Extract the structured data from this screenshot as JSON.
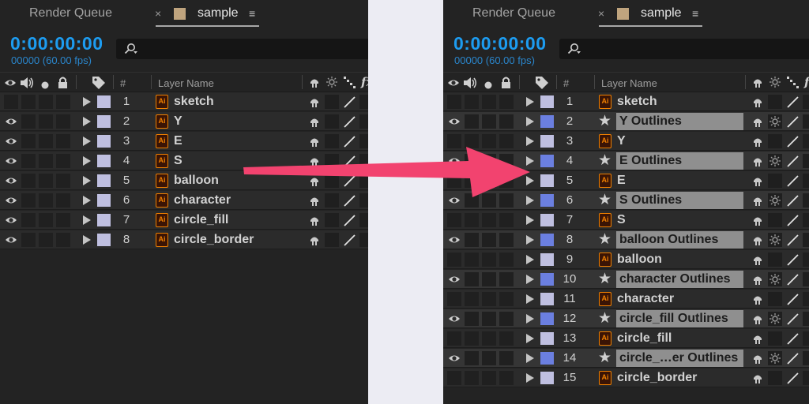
{
  "colors": {
    "accent_timecode": "#1d9cf0",
    "label_lavender": "#bfbfe0",
    "label_blue": "#6b7fe0",
    "ai_orange": "#f08000",
    "arrow": "#f2436f"
  },
  "left_panel": {
    "tabs": {
      "render_queue": "Render Queue",
      "close": "×",
      "active": "sample",
      "menu": "≡"
    },
    "timecode": "0:00:00:00",
    "frame_fps": "00000 (60.00 fps)",
    "search": {
      "icon": "search-icon",
      "placeholder": ""
    },
    "columns": {
      "number": "#",
      "layer_name": "Layer Name",
      "fx": "fx"
    },
    "layers": [
      {
        "num": "1",
        "name": "sketch",
        "type": "ai",
        "visible": false,
        "label": "lavender",
        "selected": false
      },
      {
        "num": "2",
        "name": "Y",
        "type": "ai",
        "visible": true,
        "label": "lavender",
        "selected": false
      },
      {
        "num": "3",
        "name": "E",
        "type": "ai",
        "visible": true,
        "label": "lavender",
        "selected": false
      },
      {
        "num": "4",
        "name": "S",
        "type": "ai",
        "visible": true,
        "label": "lavender",
        "selected": false
      },
      {
        "num": "5",
        "name": "balloon",
        "type": "ai",
        "visible": true,
        "label": "lavender",
        "selected": false
      },
      {
        "num": "6",
        "name": "character",
        "type": "ai",
        "visible": true,
        "label": "lavender",
        "selected": false
      },
      {
        "num": "7",
        "name": "circle_fill",
        "type": "ai",
        "visible": true,
        "label": "lavender",
        "selected": false
      },
      {
        "num": "8",
        "name": "circle_border",
        "type": "ai",
        "visible": true,
        "label": "lavender",
        "selected": false
      }
    ]
  },
  "right_panel": {
    "tabs": {
      "render_queue": "Render Queue",
      "close": "×",
      "active": "sample",
      "menu": "≡"
    },
    "timecode": "0:00:00:00",
    "frame_fps": "00000 (60.00 fps)",
    "search": {
      "icon": "search-icon",
      "placeholder": ""
    },
    "columns": {
      "number": "#",
      "layer_name": "Layer Name",
      "fx": "fx"
    },
    "layers": [
      {
        "num": "1",
        "name": "sketch",
        "type": "ai",
        "visible": false,
        "label": "lavender",
        "selected": false
      },
      {
        "num": "2",
        "name": "Y Outlines",
        "type": "shape",
        "visible": true,
        "label": "blue",
        "selected": true
      },
      {
        "num": "3",
        "name": "Y",
        "type": "ai",
        "visible": false,
        "label": "lavender",
        "selected": false
      },
      {
        "num": "4",
        "name": "E Outlines",
        "type": "shape",
        "visible": true,
        "label": "blue",
        "selected": true
      },
      {
        "num": "5",
        "name": "E",
        "type": "ai",
        "visible": false,
        "label": "lavender",
        "selected": false
      },
      {
        "num": "6",
        "name": "S Outlines",
        "type": "shape",
        "visible": true,
        "label": "blue",
        "selected": true
      },
      {
        "num": "7",
        "name": "S",
        "type": "ai",
        "visible": false,
        "label": "lavender",
        "selected": false
      },
      {
        "num": "8",
        "name": "balloon Outlines",
        "type": "shape",
        "visible": true,
        "label": "blue",
        "selected": true
      },
      {
        "num": "9",
        "name": "balloon",
        "type": "ai",
        "visible": false,
        "label": "lavender",
        "selected": false
      },
      {
        "num": "10",
        "name": "character Outlines",
        "type": "shape",
        "visible": true,
        "label": "blue",
        "selected": true
      },
      {
        "num": "11",
        "name": "character",
        "type": "ai",
        "visible": false,
        "label": "lavender",
        "selected": false
      },
      {
        "num": "12",
        "name": "circle_fill Outlines",
        "type": "shape",
        "visible": true,
        "label": "blue",
        "selected": true
      },
      {
        "num": "13",
        "name": "circle_fill",
        "type": "ai",
        "visible": false,
        "label": "lavender",
        "selected": false
      },
      {
        "num": "14",
        "name": "circle_…er Outlines",
        "type": "shape",
        "visible": true,
        "label": "blue",
        "selected": true
      },
      {
        "num": "15",
        "name": "circle_border",
        "type": "ai",
        "visible": false,
        "label": "lavender",
        "selected": false
      }
    ]
  }
}
